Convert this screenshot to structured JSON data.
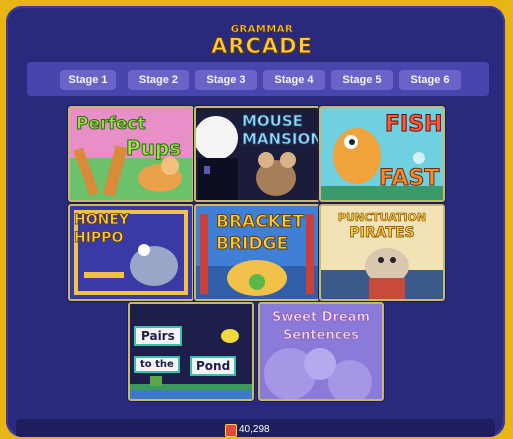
{
  "header": {
    "logo_line1": "GRAMMAR",
    "logo_line2": "ARCADE"
  },
  "stages": [
    "Stage 1",
    "Stage 2",
    "Stage 3",
    "Stage 4",
    "Stage 5",
    "Stage 6"
  ],
  "games": [
    {
      "title_line1": "Perfect",
      "title_line2": "Pups"
    },
    {
      "title_line1": "MOUSE",
      "title_line2": "MANSION"
    },
    {
      "title_line1": "FISH",
      "title_line2": "FAST"
    },
    {
      "title_line1": "HONEY",
      "title_line2": "HIPPO"
    },
    {
      "title_line1": "BRACKET",
      "title_line2": "BRIDGE"
    },
    {
      "title_line1": "PUNCTUATION",
      "title_line2": "PIRATES"
    },
    {
      "title_line1": "Pairs",
      "title_line2": "to the",
      "title_line3": "Pond"
    },
    {
      "title_line1": "Sweet Dream",
      "title_line2": "Sentences"
    }
  ],
  "footer": {
    "coins": "40,298"
  },
  "colors": {
    "background": "#2a2a7c",
    "gold": "#ffcf3a",
    "stage_button": "#6a64c9"
  }
}
